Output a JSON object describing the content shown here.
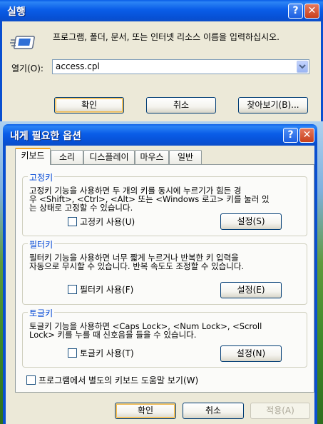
{
  "run_dialog": {
    "title": "실행",
    "description": "프로그램, 폴더, 문서, 또는 인터넷 리소스 이름을 입력하십시오.",
    "open_label": "열기(O):",
    "open_value": "access.cpl",
    "buttons": {
      "ok": "확인",
      "cancel": "취소",
      "browse": "찾아보기(B)..."
    }
  },
  "options_dialog": {
    "title": "내게 필요한 옵션",
    "tabs": [
      "키보드",
      "소리",
      "디스플레이",
      "마우스",
      "일반"
    ],
    "sticky": {
      "legend": "고정키",
      "description": "고정키 기능을 사용하면 두 개의 키를 동시에 누르기가 힘든 경\n우 <Shift>, <Ctrl>, <Alt> 또는 <Windows 로고> 키를 눌러 있\n는 상태로 고정할 수 있습니다.",
      "checkbox": "고정키 사용(U)",
      "settings": "설정(S)"
    },
    "filter": {
      "legend": "필터키",
      "description": "필터키 기능을 사용하면 너무 짧게 누르거나 반복한 키 입력을\n자동으로 무시할 수 있습니다. 반복 속도도 조정할 수 있습니다.",
      "checkbox": "필터키 사용(F)",
      "settings": "설정(E)"
    },
    "toggle": {
      "legend": "토글키",
      "description": "토글키 기능을 사용하면 <Caps Lock>, <Num Lock>, <Scroll\nLock> 키를 누를 때 신호음을 들을 수 있습니다.",
      "checkbox": "토글키 사용(T)",
      "settings": "설정(N)"
    },
    "extra_checkbox": "프로그램에서 별도의 키보드 도움말 보기(W)",
    "buttons": {
      "ok": "확인",
      "cancel": "취소",
      "apply": "적용(A)"
    }
  },
  "icons": {
    "run": "run-icon",
    "help": "help-icon",
    "close": "close-icon",
    "dropdown": "chevron-down-icon"
  },
  "colors": {
    "titlebar": "#0a5ce6",
    "dialog_bg": "#ece9d8",
    "legend": "#0046d5"
  }
}
